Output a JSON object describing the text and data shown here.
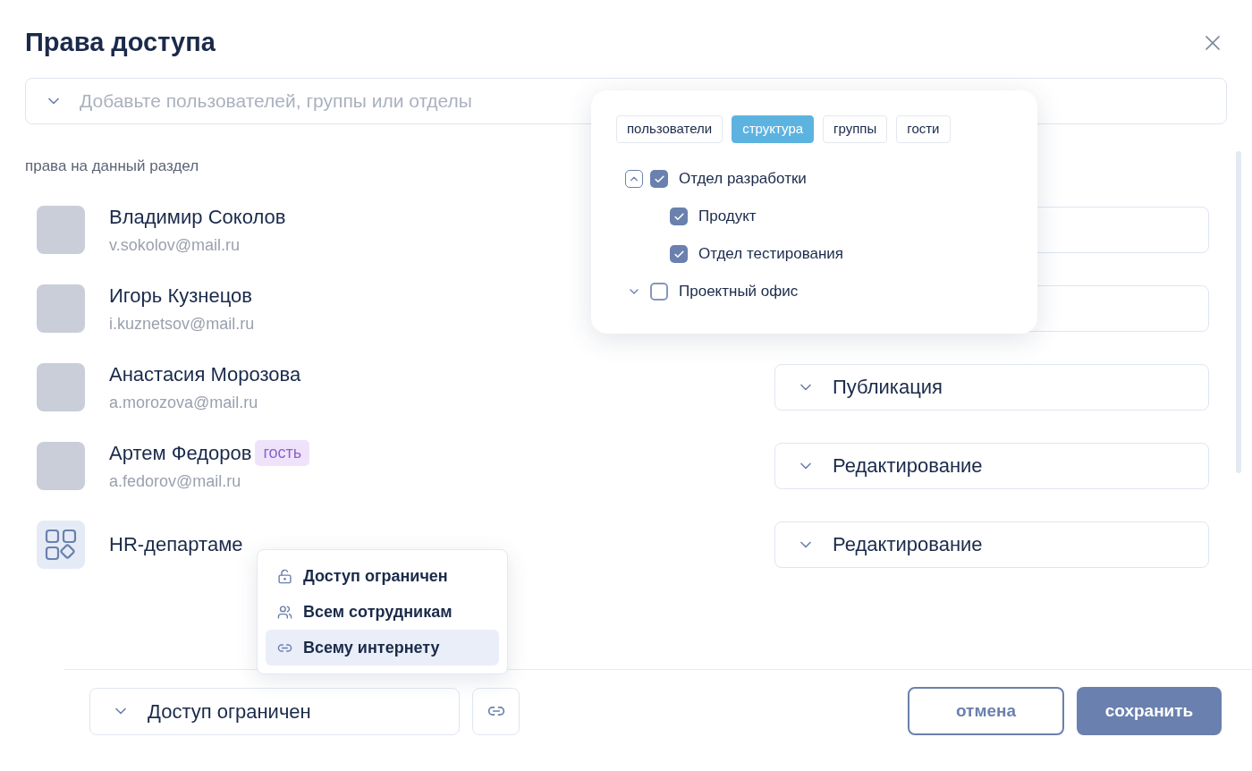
{
  "dialog": {
    "title": "Права доступа"
  },
  "add_field": {
    "placeholder": "Добавьте пользователей, группы или отделы"
  },
  "section_label": "права на данный раздел",
  "members": [
    {
      "kind": "person",
      "name": "Владимир Соколов",
      "email": "v.sokolov@mail.ru"
    },
    {
      "kind": "person",
      "name": "Игорь Кузнецов",
      "email": "i.kuznetsov@mail.ru"
    },
    {
      "kind": "person",
      "name": "Анастасия Морозова",
      "email": "a.morozova@mail.ru",
      "permission": "Публикация"
    },
    {
      "kind": "person",
      "name": "Артем Федоров",
      "email": "a.fedorov@mail.ru",
      "badge": "гость",
      "permission": "Редактирование"
    },
    {
      "kind": "group",
      "name": "HR-департаме",
      "permission": "Редактирование"
    }
  ],
  "picker": {
    "tabs": [
      {
        "label": "пользователи",
        "selected": false
      },
      {
        "label": "структура",
        "selected": true
      },
      {
        "label": "группы",
        "selected": false
      },
      {
        "label": "гости",
        "selected": false
      }
    ],
    "tree": [
      {
        "label": "Отдел разработки",
        "checked": true,
        "expanded": true,
        "children": [
          {
            "label": "Продукт",
            "checked": true
          },
          {
            "label": "Отдел тестирования",
            "checked": true
          }
        ]
      },
      {
        "label": "Проектный офис",
        "checked": false,
        "expanded": false
      }
    ]
  },
  "access_menu": [
    {
      "kind": "lock",
      "label": "Доступ ограничен",
      "selected": false
    },
    {
      "kind": "people",
      "label": "Всем сотрудникам",
      "selected": false
    },
    {
      "kind": "link",
      "label": "Всему интернету",
      "selected": true
    }
  ],
  "footer": {
    "access_select": "Доступ ограничен",
    "cancel": "отмена",
    "save": "сохранить"
  }
}
